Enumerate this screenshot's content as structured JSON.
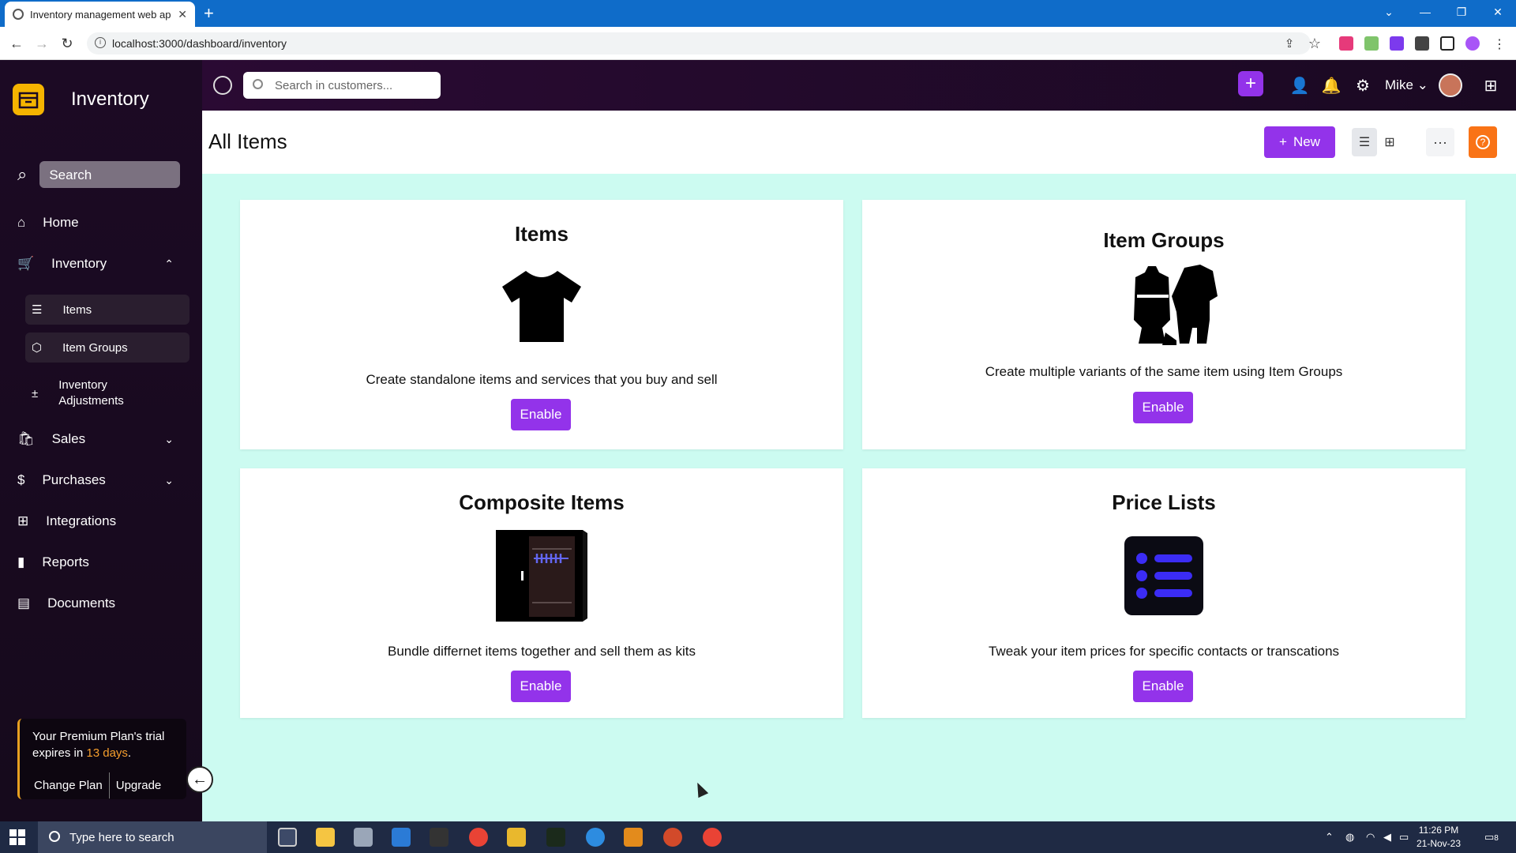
{
  "browser": {
    "tab_title": "Inventory management web app",
    "tab_close": "✕",
    "new_tab": "+",
    "url": "localhost:3000/dashboard/inventory"
  },
  "sidebar": {
    "brand": "Inventory",
    "search_label": "Search",
    "nav": {
      "home": "Home",
      "inventory": "Inventory",
      "sales": "Sales",
      "purchases": "Purchases",
      "integrations": "Integrations",
      "reports": "Reports",
      "documents": "Documents"
    },
    "sub": {
      "items": "Items",
      "item_groups": "Item Groups",
      "adjustments": "Inventory Adjustments"
    },
    "trial": {
      "prefix": "Your Premium Plan's trial expires in ",
      "days": "13 days",
      "suffix": ".",
      "change_plan": "Change Plan",
      "upgrade": "Upgrade"
    }
  },
  "topbar": {
    "search_placeholder": "Search in customers...",
    "user": "Mike"
  },
  "header": {
    "title": "All Items",
    "new_label": "New"
  },
  "cards": [
    {
      "title": "Items",
      "desc": "Create standalone items and services that you buy and sell",
      "button": "Enable",
      "icon": "tshirt-icon"
    },
    {
      "title": "Item Groups",
      "desc": "Create multiple variants of the same item using Item Groups",
      "button": "Enable",
      "icon": "clothing-set-icon"
    },
    {
      "title": "Composite Items",
      "desc": "Bundle differnet items together and sell them as kits",
      "button": "Enable",
      "icon": "wardrobe-icon"
    },
    {
      "title": "Price Lists",
      "desc": "Tweak your item prices for specific contacts or transcations",
      "button": "Enable",
      "icon": "list-icon"
    }
  ],
  "taskbar": {
    "search_placeholder": "Type here to search",
    "time": "11:26 PM",
    "date": "21-Nov-23",
    "notification_count": "8"
  },
  "colors": {
    "accent": "#9333ea",
    "sidebar_bg": "#1c0a24",
    "main_bg": "#ccfbf1",
    "help": "#f97316",
    "trial_days": "#f59e2c"
  }
}
